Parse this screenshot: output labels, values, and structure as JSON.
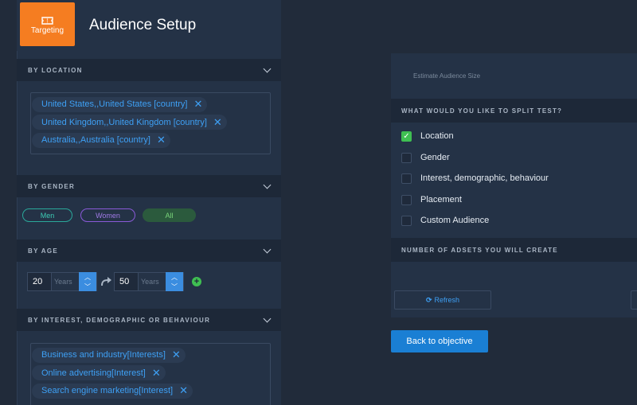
{
  "header": {
    "targeting_label": "Targeting",
    "title": "Audience Setup"
  },
  "location": {
    "heading": "BY LOCATION",
    "tags": [
      "United States,,United States [country]",
      "United Kingdom,,United Kingdom [country]",
      "Australia,,Australia [country]"
    ]
  },
  "gender": {
    "heading": "BY GENDER",
    "options": [
      "Men",
      "Women",
      "All"
    ],
    "selected": "All"
  },
  "age": {
    "heading": "BY AGE",
    "from": "20",
    "to": "50",
    "unit": "Years"
  },
  "interests": {
    "heading": "BY INTEREST, DEMOGRAPHIC OR BEHAVIOUR",
    "tags": [
      "Business and industry[Interests]",
      "Online advertising[Interest]",
      "Search engine marketing[Interest]"
    ]
  },
  "right": {
    "estimate_label": "Estimate Audience Size",
    "split_heading": "WHAT WOULD YOU LIKE TO SPLIT TEST?",
    "options": [
      {
        "label": "Location",
        "checked": true
      },
      {
        "label": "Gender",
        "checked": false
      },
      {
        "label": "Interest, demographic, behaviour",
        "checked": false
      },
      {
        "label": "Placement",
        "checked": false
      },
      {
        "label": "Custom Audience",
        "checked": false
      }
    ],
    "adsets_heading": "NUMBER OF ADSETS YOU WILL CREATE",
    "refresh_label": "Refresh"
  },
  "back_label": "Back to objective",
  "colors": {
    "accent_orange": "#f57d21",
    "link_blue": "#3ea0f5",
    "check_green": "#3fbf52",
    "primary_button": "#1a7fd4"
  }
}
